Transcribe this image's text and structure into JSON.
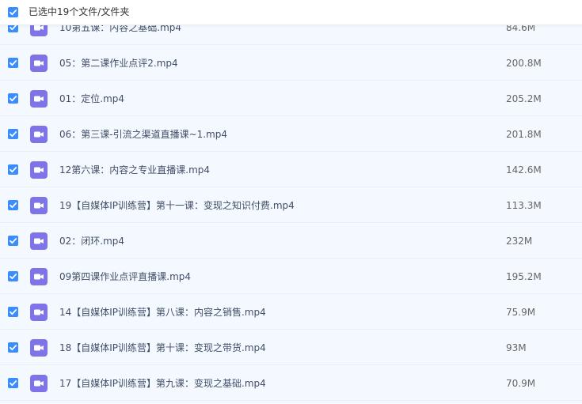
{
  "header": {
    "selection_text": "已选中19个文件/文件夹",
    "checked": true
  },
  "files": [
    {
      "name": "10第五课：内容之基础.mp4",
      "size": "84.6M",
      "checked": true
    },
    {
      "name": "05：第二课作业点评2.mp4",
      "size": "200.8M",
      "checked": true
    },
    {
      "name": "01：定位.mp4",
      "size": "205.2M",
      "checked": true
    },
    {
      "name": "06：第三课-引流之渠道直播课~1.mp4",
      "size": "201.8M",
      "checked": true
    },
    {
      "name": "12第六课：内容之专业直播课.mp4",
      "size": "142.6M",
      "checked": true
    },
    {
      "name": "19【自媒体IP训练营】第十一课：变现之知识付费.mp4",
      "size": "113.3M",
      "checked": true
    },
    {
      "name": "02：闭环.mp4",
      "size": "232M",
      "checked": true
    },
    {
      "name": "09第四课作业点评直播课.mp4",
      "size": "195.2M",
      "checked": true
    },
    {
      "name": "14【自媒体IP训练营】第八课：内容之销售.mp4",
      "size": "75.9M",
      "checked": true
    },
    {
      "name": "18【自媒体IP训练营】第十课：变现之带货.mp4",
      "size": "93M",
      "checked": true
    },
    {
      "name": "17【自媒体IP训练营】第九课：变现之基础.mp4",
      "size": "70.9M",
      "checked": true
    }
  ],
  "colors": {
    "checkbox": "#3b8cff",
    "video_icon": "#7d74e8",
    "row_selected_bg": "#f3f9ff"
  },
  "icons": {
    "file_type": "video-file-icon",
    "check": "checkbox-checked-icon"
  }
}
